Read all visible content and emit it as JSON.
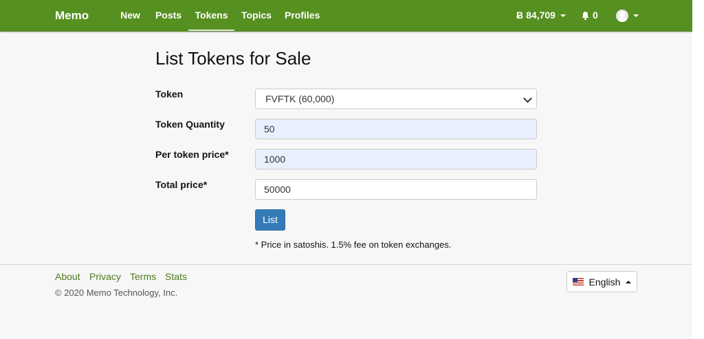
{
  "navbar": {
    "brand": "Memo",
    "items": [
      {
        "label": "New"
      },
      {
        "label": "Posts"
      },
      {
        "label": "Tokens"
      },
      {
        "label": "Topics"
      },
      {
        "label": "Profiles"
      }
    ],
    "active": "Tokens",
    "balance_symbol": "Ƀ",
    "balance": "84,709",
    "notifications": "0",
    "color": "#569020"
  },
  "page": {
    "title": "List Tokens for Sale"
  },
  "form": {
    "token_label": "Token",
    "token_selected": "FVFTK (60,000)",
    "quantity_label": "Token Quantity",
    "quantity_value": "50",
    "price_label": "Per token price*",
    "price_value": "1000",
    "total_label": "Total price*",
    "total_value": "50000",
    "submit_label": "List",
    "note": "* Price in satoshis. 1.5% fee on token exchanges.",
    "button_color": "#337ab7"
  },
  "footer": {
    "links": [
      {
        "label": "About"
      },
      {
        "label": "Privacy"
      },
      {
        "label": "Terms"
      },
      {
        "label": "Stats"
      }
    ],
    "copyright": "© 2020 Memo Technology, Inc.",
    "language": "English",
    "link_color": "#4d7b1d"
  }
}
